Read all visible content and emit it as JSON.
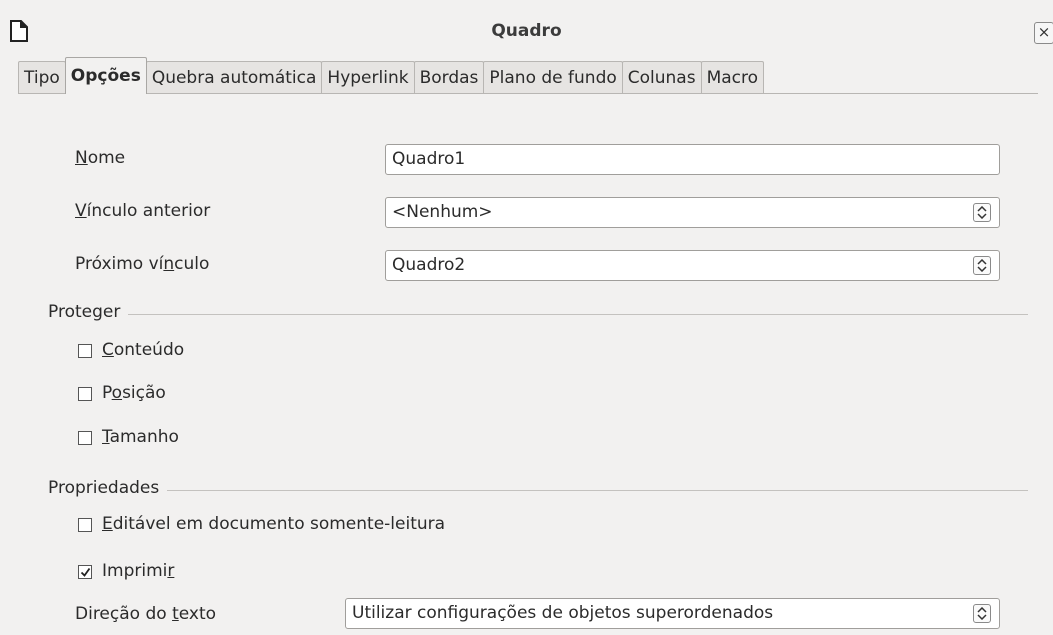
{
  "window": {
    "title": "Quadro",
    "close_glyph": "×",
    "icon": "document-icon"
  },
  "tabs": [
    {
      "label": "Tipo",
      "active": false
    },
    {
      "label": "Opções",
      "active": true
    },
    {
      "label": "Quebra automática",
      "active": false
    },
    {
      "label": "Hyperlink",
      "active": false
    },
    {
      "label": "Bordas",
      "active": false
    },
    {
      "label": "Plano de fundo",
      "active": false
    },
    {
      "label": "Colunas",
      "active": false
    },
    {
      "label": "Macro",
      "active": false
    }
  ],
  "fields": {
    "nome": {
      "label_mnemonic": "N",
      "label_rest": "ome",
      "value": "Quadro1"
    },
    "vinculo_anterior": {
      "label_mnemonic": "V",
      "label_rest": "ínculo anterior",
      "value": "<Nenhum>"
    },
    "proximo_vinculo": {
      "label_pre": "Próximo ví",
      "label_mnemonic": "n",
      "label_rest": "culo",
      "value": "Quadro2"
    }
  },
  "proteger": {
    "title": "Proteger",
    "items": [
      {
        "pre": "",
        "mnemonic": "C",
        "rest": "onteúdo",
        "checked": false
      },
      {
        "pre": "P",
        "mnemonic": "o",
        "rest": "sição",
        "checked": false
      },
      {
        "pre": "",
        "mnemonic": "T",
        "rest": "amanho",
        "checked": false
      }
    ]
  },
  "propriedades": {
    "title": "Propriedades",
    "items": [
      {
        "pre": "",
        "mnemonic": "E",
        "rest": "ditável em documento somente-leitura",
        "checked": false
      },
      {
        "pre": "Imprimi",
        "mnemonic": "r",
        "rest": "",
        "checked": true
      }
    ],
    "direcao": {
      "label_pre": "Direção do ",
      "label_mnemonic": "t",
      "label_rest": "exto",
      "value": "Utilizar configurações de objetos superordenados"
    }
  }
}
